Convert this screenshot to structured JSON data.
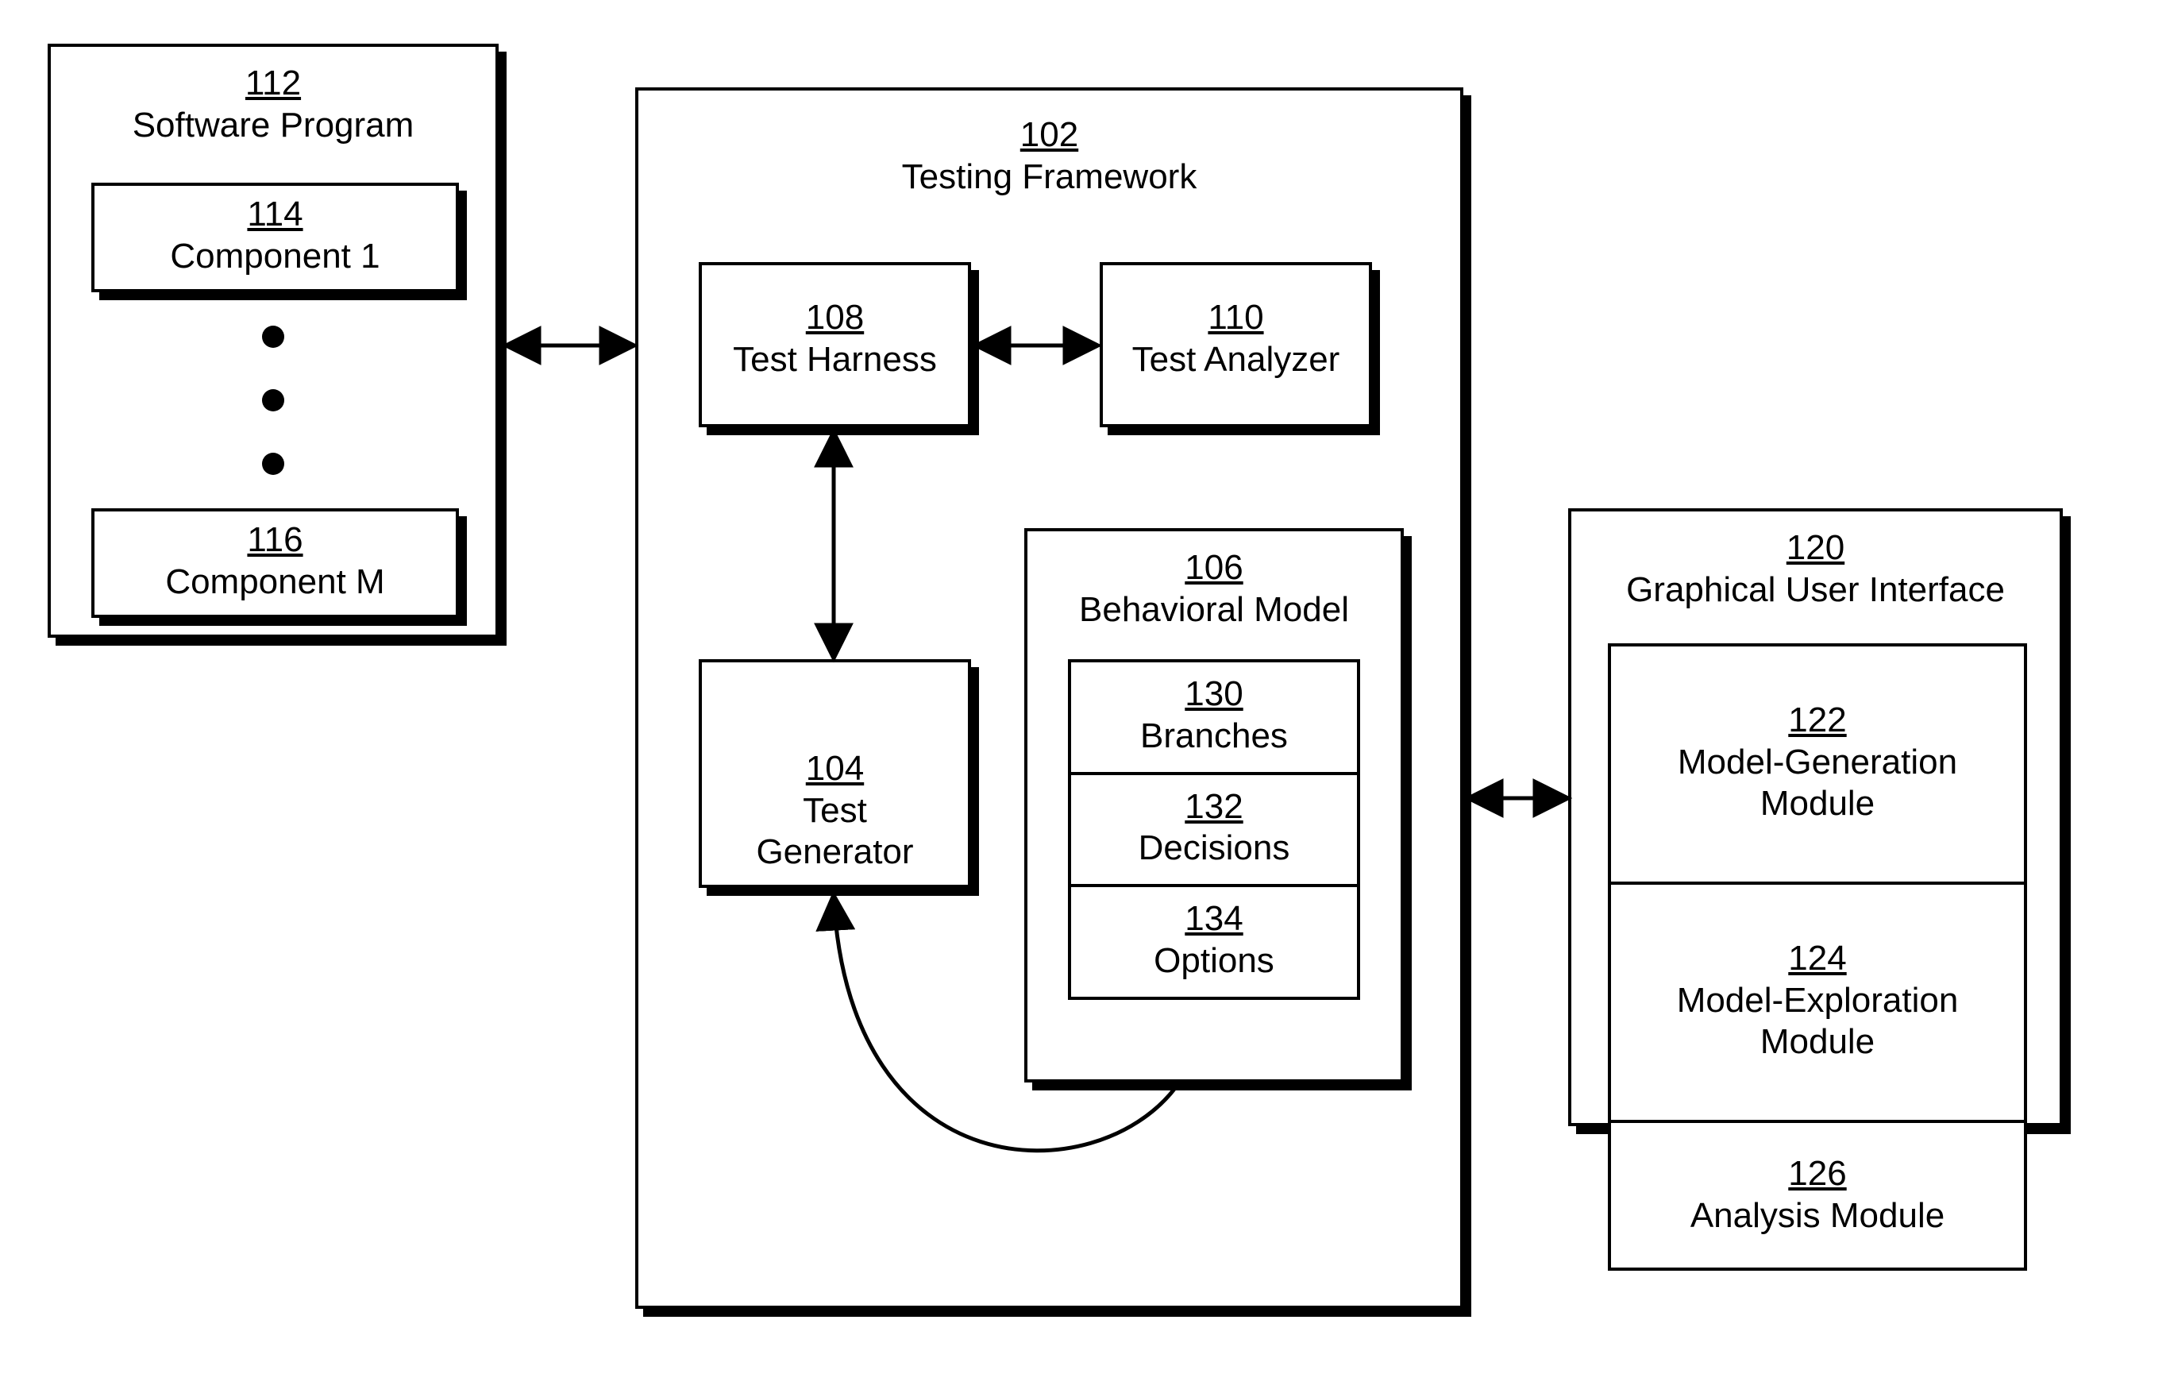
{
  "boxes": {
    "software_program": {
      "ref": "112",
      "label": "Software Program"
    },
    "component_1": {
      "ref": "114",
      "label": "Component 1"
    },
    "component_m": {
      "ref": "116",
      "label": "Component M"
    },
    "testing_framework": {
      "ref": "102",
      "label": "Testing Framework"
    },
    "test_harness": {
      "ref": "108",
      "label": "Test Harness"
    },
    "test_analyzer": {
      "ref": "110",
      "label": "Test Analyzer"
    },
    "test_generator": {
      "ref": "104",
      "label": "Test\nGenerator"
    },
    "behavioral_model": {
      "ref": "106",
      "label": "Behavioral Model"
    },
    "branches": {
      "ref": "130",
      "label": "Branches"
    },
    "decisions": {
      "ref": "132",
      "label": "Decisions"
    },
    "options": {
      "ref": "134",
      "label": "Options"
    },
    "gui": {
      "ref": "120",
      "label": "Graphical User Interface"
    },
    "model_generation": {
      "ref": "122",
      "label": "Model-Generation\nModule"
    },
    "model_exploration": {
      "ref": "124",
      "label": "Model-Exploration\nModule"
    },
    "analysis_module": {
      "ref": "126",
      "label": "Analysis Module"
    }
  }
}
